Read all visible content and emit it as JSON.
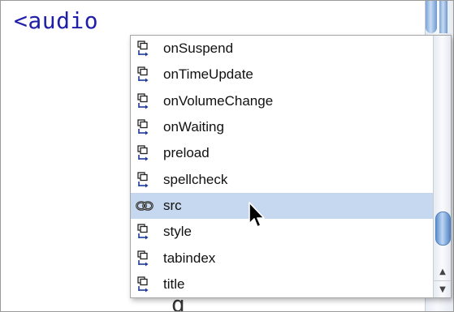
{
  "editor": {
    "code_text": "<audio",
    "bottom_partial_text": "g"
  },
  "autocomplete": {
    "items": [
      {
        "label": "onSuspend",
        "icon": "event-attribute-icon"
      },
      {
        "label": "onTimeUpdate",
        "icon": "event-attribute-icon"
      },
      {
        "label": "onVolumeChange",
        "icon": "event-attribute-icon"
      },
      {
        "label": "onWaiting",
        "icon": "event-attribute-icon"
      },
      {
        "label": "preload",
        "icon": "event-attribute-icon"
      },
      {
        "label": "spellcheck",
        "icon": "event-attribute-icon"
      },
      {
        "label": "src",
        "icon": "link-icon",
        "selected": true
      },
      {
        "label": "style",
        "icon": "event-attribute-icon"
      },
      {
        "label": "tabindex",
        "icon": "event-attribute-icon"
      },
      {
        "label": "title",
        "icon": "event-attribute-icon"
      }
    ],
    "scroll_up_glyph": "▲",
    "scroll_down_glyph": "▼"
  },
  "colors": {
    "code_text": "#1f1fa8",
    "selection": "#c6d8ef",
    "scroll_thumb": "#5c8fd0"
  }
}
